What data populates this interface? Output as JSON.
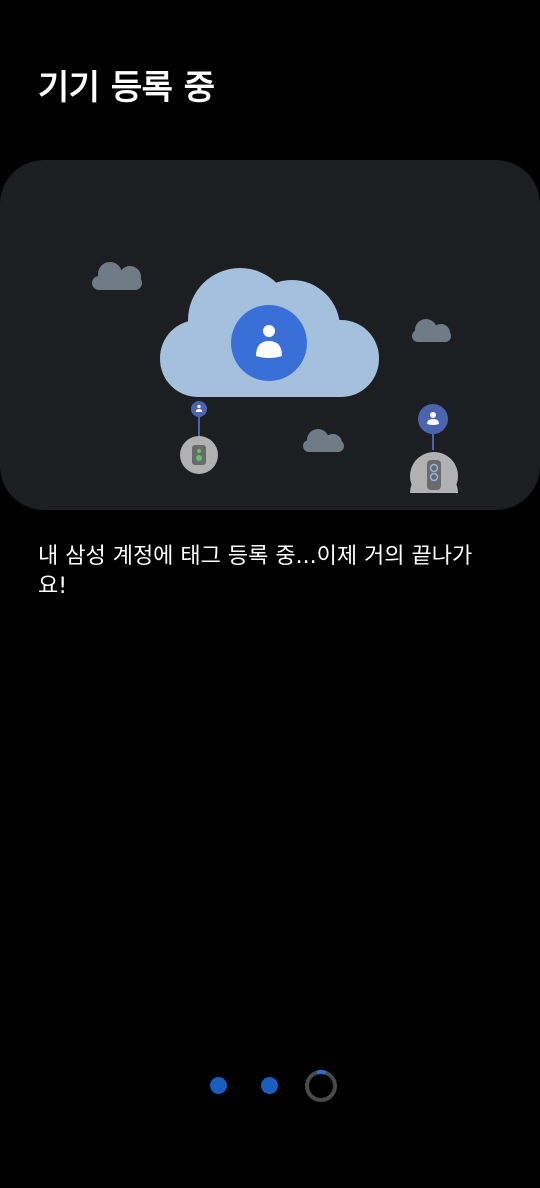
{
  "header": {
    "title": "기기 등록 중"
  },
  "illustration": {
    "main_icon": "account-icon",
    "left_device_icon": "speaker-device-icon",
    "right_device_icon": "speaker-device-icon",
    "small_clouds": [
      "cloud-icon",
      "cloud-icon",
      "cloud-icon"
    ]
  },
  "message": {
    "text": "내 삼성 계정에 태그 등록 중...이제 거의 끝나가요!"
  },
  "progress": {
    "completed_steps": 2,
    "current_step": 3,
    "total_steps": 3
  },
  "colors": {
    "background": "#000000",
    "card": "#1c1e21",
    "main_cloud": "#a4c0dc",
    "small_cloud": "#6f7b86",
    "account_blue": "#3a6fd8",
    "device_gray": "#b1b1b1",
    "small_avatar": "#4a64b0",
    "step_dot": "#1a5fbf",
    "spinner_track": "#4a4a4a",
    "spinner_arc": "#2a6fd6"
  }
}
